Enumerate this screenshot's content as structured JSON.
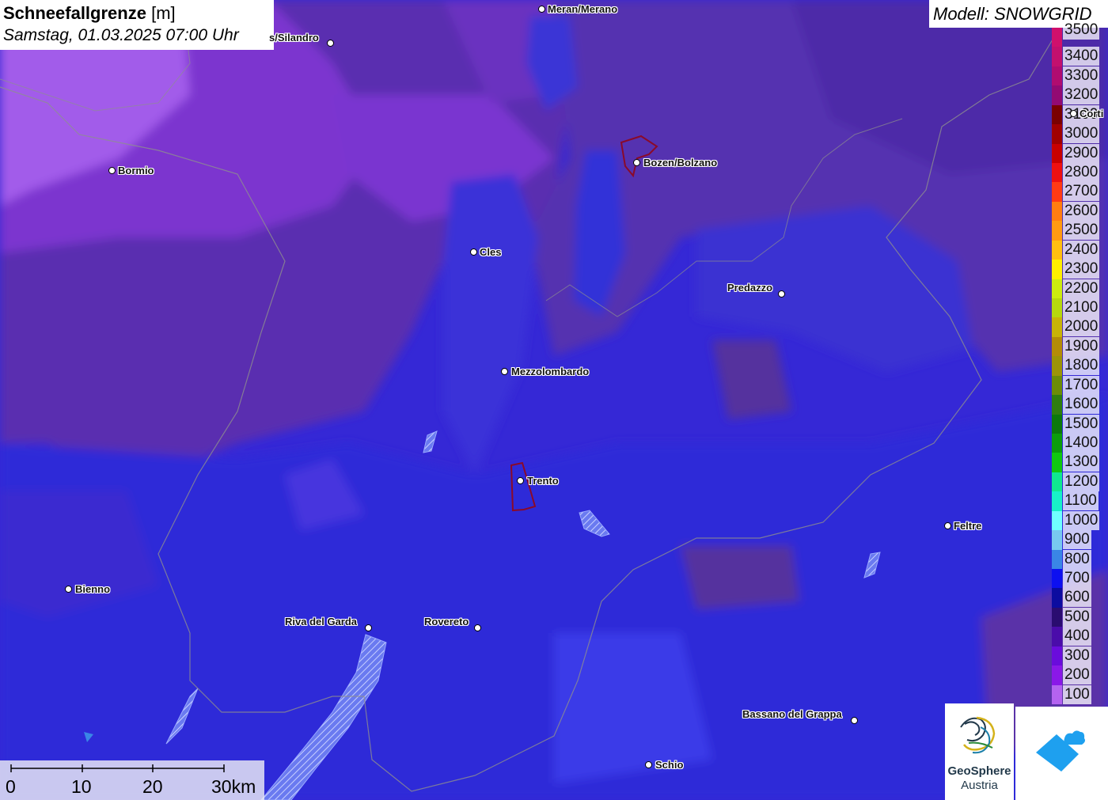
{
  "title": {
    "main": "Schneefallgrenze",
    "unit": "[m]",
    "subtitle": "Samstag, 01.03.2025 07:00 Uhr"
  },
  "model": {
    "label": "Modell: SNOWGRID"
  },
  "legend": {
    "items": [
      {
        "label": "3500",
        "color": "#d0106c"
      },
      {
        "label": "3400",
        "color": "#c3106e"
      },
      {
        "label": "3300",
        "color": "#b00c70"
      },
      {
        "label": "3200",
        "color": "#930a73"
      },
      {
        "label": "3100",
        "color": "#7a0000"
      },
      {
        "label": "3000",
        "color": "#a00000"
      },
      {
        "label": "2900",
        "color": "#c80000"
      },
      {
        "label": "2800",
        "color": "#ee1010"
      },
      {
        "label": "2700",
        "color": "#ff3a14"
      },
      {
        "label": "2600",
        "color": "#ff7d10"
      },
      {
        "label": "2500",
        "color": "#ff9a10"
      },
      {
        "label": "2400",
        "color": "#ffbf10"
      },
      {
        "label": "2300",
        "color": "#fff000"
      },
      {
        "label": "2200",
        "color": "#ccec10"
      },
      {
        "label": "2100",
        "color": "#b6d80e"
      },
      {
        "label": "2000",
        "color": "#c8b408"
      },
      {
        "label": "1900",
        "color": "#b48c08"
      },
      {
        "label": "1800",
        "color": "#9c9408"
      },
      {
        "label": "1700",
        "color": "#6c8c08"
      },
      {
        "label": "1600",
        "color": "#2f7d10"
      },
      {
        "label": "1500",
        "color": "#0c780c"
      },
      {
        "label": "1400",
        "color": "#0c9c0c"
      },
      {
        "label": "1300",
        "color": "#10c810"
      },
      {
        "label": "1200",
        "color": "#10e890"
      },
      {
        "label": "1100",
        "color": "#18f0c8"
      },
      {
        "label": "1000",
        "color": "#70ffff"
      },
      {
        "label": "900",
        "color": "#78c8f0"
      },
      {
        "label": "800",
        "color": "#3a86e6"
      },
      {
        "label": "700",
        "color": "#0d10f0"
      },
      {
        "label": "600",
        "color": "#0c0ca0"
      },
      {
        "label": "500",
        "color": "#2a0c70"
      },
      {
        "label": "400",
        "color": "#4a0caa"
      },
      {
        "label": "300",
        "color": "#6a0cdc"
      },
      {
        "label": "200",
        "color": "#8a18e8"
      },
      {
        "label": "100",
        "color": "#b463f0"
      }
    ]
  },
  "cities": [
    {
      "name": "Meran/Merano"
    },
    {
      "name": "s/Silandro"
    },
    {
      "name": "Bormio"
    },
    {
      "name": "Bozen/Bolzano"
    },
    {
      "name": "Cles"
    },
    {
      "name": "Predazzo"
    },
    {
      "name": "Corti"
    },
    {
      "name": "Mezzolombardo"
    },
    {
      "name": "Trento"
    },
    {
      "name": "Feltre"
    },
    {
      "name": "Bienno"
    },
    {
      "name": "Riva del Garda"
    },
    {
      "name": "Rovereto"
    },
    {
      "name": "Bassano del Grappa"
    },
    {
      "name": "Schio"
    }
  ],
  "scale": {
    "labels": [
      "0",
      "10",
      "20",
      "30km"
    ]
  },
  "logos": {
    "geosphere_line1": "GeoSphere",
    "geosphere_line2": "Austria"
  },
  "colors": {
    "purple_high": "#8a3ad6",
    "purple_mid": "#5a30a8",
    "blue_mid": "#3a2fd8",
    "blue_low": "#2a24e8",
    "logo_blue": "#1ea0ef"
  }
}
